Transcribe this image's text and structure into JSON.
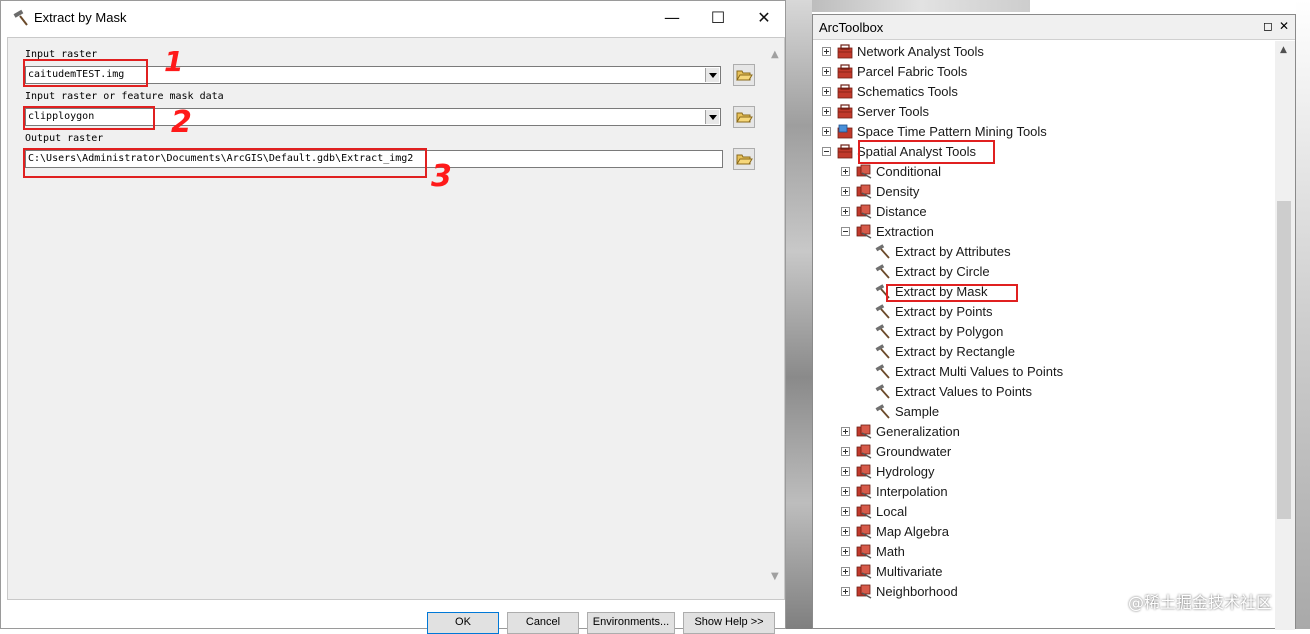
{
  "dialog": {
    "title": "Extract by Mask",
    "minimize": "—",
    "maximize": "☐",
    "close": "✕",
    "fields": {
      "input_raster_label": "Input raster",
      "input_raster_value": "caitudemTEST.img",
      "mask_label": "Input raster or feature mask data",
      "mask_value": "clipploygon",
      "output_label": "Output raster",
      "output_value": "C:\\Users\\Administrator\\Documents\\ArcGIS\\Default.gdb\\Extract_img2"
    },
    "annotations": [
      "1",
      "2",
      "3"
    ],
    "buttons": {
      "ok": "OK",
      "cancel": "Cancel",
      "environments": "Environments...",
      "show_help": "Show Help >>"
    }
  },
  "toolbox": {
    "title": "ArcToolbox",
    "items": [
      {
        "label": "Network Analyst Tools",
        "level": 0,
        "kind": "toolbox",
        "expanded": false
      },
      {
        "label": "Parcel Fabric Tools",
        "level": 0,
        "kind": "toolbox",
        "expanded": false
      },
      {
        "label": "Schematics Tools",
        "level": 0,
        "kind": "toolbox",
        "expanded": false
      },
      {
        "label": "Server Tools",
        "level": 0,
        "kind": "toolbox",
        "expanded": false
      },
      {
        "label": "Space Time Pattern Mining Tools",
        "level": 0,
        "kind": "toolbox-blue",
        "expanded": false
      },
      {
        "label": "Spatial Analyst Tools",
        "level": 0,
        "kind": "toolbox",
        "expanded": true
      },
      {
        "label": "Conditional",
        "level": 1,
        "kind": "toolset",
        "expanded": false
      },
      {
        "label": "Density",
        "level": 1,
        "kind": "toolset",
        "expanded": false
      },
      {
        "label": "Distance",
        "level": 1,
        "kind": "toolset",
        "expanded": false
      },
      {
        "label": "Extraction",
        "level": 1,
        "kind": "toolset",
        "expanded": true
      },
      {
        "label": "Extract by Attributes",
        "level": 2,
        "kind": "tool"
      },
      {
        "label": "Extract by Circle",
        "level": 2,
        "kind": "tool"
      },
      {
        "label": "Extract by Mask",
        "level": 2,
        "kind": "tool"
      },
      {
        "label": "Extract by Points",
        "level": 2,
        "kind": "tool"
      },
      {
        "label": "Extract by Polygon",
        "level": 2,
        "kind": "tool"
      },
      {
        "label": "Extract by Rectangle",
        "level": 2,
        "kind": "tool"
      },
      {
        "label": "Extract Multi Values to Points",
        "level": 2,
        "kind": "tool"
      },
      {
        "label": "Extract Values to Points",
        "level": 2,
        "kind": "tool"
      },
      {
        "label": "Sample",
        "level": 2,
        "kind": "tool"
      },
      {
        "label": "Generalization",
        "level": 1,
        "kind": "toolset",
        "expanded": false
      },
      {
        "label": "Groundwater",
        "level": 1,
        "kind": "toolset",
        "expanded": false
      },
      {
        "label": "Hydrology",
        "level": 1,
        "kind": "toolset",
        "expanded": false
      },
      {
        "label": "Interpolation",
        "level": 1,
        "kind": "toolset",
        "expanded": false
      },
      {
        "label": "Local",
        "level": 1,
        "kind": "toolset",
        "expanded": false
      },
      {
        "label": "Map Algebra",
        "level": 1,
        "kind": "toolset",
        "expanded": false
      },
      {
        "label": "Math",
        "level": 1,
        "kind": "toolset",
        "expanded": false
      },
      {
        "label": "Multivariate",
        "level": 1,
        "kind": "toolset",
        "expanded": false
      },
      {
        "label": "Neighborhood",
        "level": 1,
        "kind": "toolset",
        "expanded": false
      }
    ]
  },
  "watermark": "@稀土掘金技术社区",
  "colors": {
    "highlight_box": "#e02020",
    "ok_border": "#0078d7"
  }
}
